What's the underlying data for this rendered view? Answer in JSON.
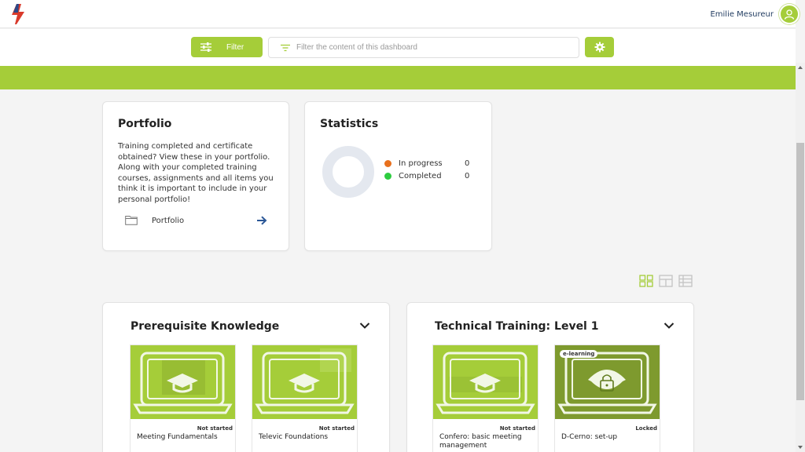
{
  "header": {
    "logo_icon": "lightning-bolt-logo-icon",
    "user_name": "Emilie Mesureur",
    "avatar_icon": "user-avatar-icon"
  },
  "filterbar": {
    "filter_label": "Filter",
    "search_placeholder": "Filter the content of this dashboard",
    "search_value": "",
    "settings_icon": "gear-icon"
  },
  "colors": {
    "accent": "#a5cd39",
    "accent_dark": "#7e9a2e",
    "in_progress": "#e8701d",
    "completed": "#2ecc40",
    "link_arrow": "#2b5797"
  },
  "portfolio_card": {
    "title": "Portfolio",
    "description": "Training completed and certificate obtained? View these in your portfolio. Along with your completed training courses, assignments and all items you think it is important to include in your personal portfolio!",
    "link_label": "Portfolio"
  },
  "statistics_card": {
    "title": "Statistics",
    "legend": [
      {
        "label": "In progress",
        "value": "0"
      },
      {
        "label": "Completed",
        "value": "0"
      }
    ]
  },
  "courses": [
    {
      "title": "Prerequisite Knowledge",
      "items": [
        {
          "title": "Meeting Fundamentals",
          "status": "Not started",
          "tag": ""
        },
        {
          "title": "Televic Foundations",
          "status": "Not started",
          "tag": ""
        }
      ]
    },
    {
      "title": "Technical Training: Level 1",
      "items": [
        {
          "title": "Confero: basic meeting management",
          "status": "Not started",
          "tag": ""
        },
        {
          "title": "D-Cerno: set-up",
          "status": "Locked",
          "tag": "e-learning"
        }
      ]
    }
  ]
}
